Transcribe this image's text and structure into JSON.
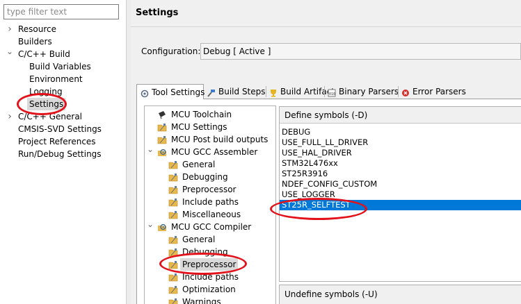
{
  "filter": {
    "placeholder": "type filter text",
    "value": ""
  },
  "nav": {
    "items": [
      {
        "label": "Resource",
        "indent": 0,
        "chevron": "right"
      },
      {
        "label": "Builders",
        "indent": 0,
        "chevron": ""
      },
      {
        "label": "C/C++ Build",
        "indent": 0,
        "chevron": "down"
      },
      {
        "label": "Build Variables",
        "indent": 1,
        "chevron": ""
      },
      {
        "label": "Environment",
        "indent": 1,
        "chevron": ""
      },
      {
        "label": "Logging",
        "indent": 1,
        "chevron": ""
      },
      {
        "label": "Settings",
        "indent": 1,
        "chevron": "",
        "selected": true
      },
      {
        "label": "C/C++ General",
        "indent": 0,
        "chevron": "right"
      },
      {
        "label": "CMSIS-SVD Settings",
        "indent": 0,
        "chevron": ""
      },
      {
        "label": "Project References",
        "indent": 0,
        "chevron": ""
      },
      {
        "label": "Run/Debug Settings",
        "indent": 0,
        "chevron": ""
      }
    ]
  },
  "page": {
    "title": "Settings",
    "config_label": "Configuration:",
    "config_value": "Debug  [ Active ]"
  },
  "tabs": [
    {
      "label": "Tool Settings",
      "icon": "tool-settings-icon",
      "active": true
    },
    {
      "label": "Build Steps",
      "icon": "build-steps-icon"
    },
    {
      "label": "Build Artifact",
      "icon": "build-artifact-icon"
    },
    {
      "label": "Binary Parsers",
      "icon": "binary-parsers-icon"
    },
    {
      "label": "Error Parsers",
      "icon": "error-parsers-icon"
    }
  ],
  "tool_tree": [
    {
      "label": "MCU Toolchain",
      "level": 0,
      "chevron": "",
      "icon": "chip"
    },
    {
      "label": "MCU Settings",
      "level": 0,
      "chevron": "",
      "icon": "folder"
    },
    {
      "label": "MCU Post build outputs",
      "level": 0,
      "chevron": "",
      "icon": "folder"
    },
    {
      "label": "MCU GCC Assembler",
      "level": 0,
      "chevron": "down",
      "icon": "gear"
    },
    {
      "label": "General",
      "level": 1,
      "chevron": "",
      "icon": "folder"
    },
    {
      "label": "Debugging",
      "level": 1,
      "chevron": "",
      "icon": "folder"
    },
    {
      "label": "Preprocessor",
      "level": 1,
      "chevron": "",
      "icon": "folder"
    },
    {
      "label": "Include paths",
      "level": 1,
      "chevron": "",
      "icon": "folder"
    },
    {
      "label": "Miscellaneous",
      "level": 1,
      "chevron": "",
      "icon": "folder"
    },
    {
      "label": "MCU GCC Compiler",
      "level": 0,
      "chevron": "down",
      "icon": "gear"
    },
    {
      "label": "General",
      "level": 1,
      "chevron": "",
      "icon": "folder"
    },
    {
      "label": "Debugging",
      "level": 1,
      "chevron": "",
      "icon": "folder"
    },
    {
      "label": "Preprocessor",
      "level": 1,
      "chevron": "",
      "icon": "folder",
      "selected": true
    },
    {
      "label": "Include paths",
      "level": 1,
      "chevron": "",
      "icon": "folder"
    },
    {
      "label": "Optimization",
      "level": 1,
      "chevron": "",
      "icon": "folder"
    },
    {
      "label": "Warnings",
      "level": 1,
      "chevron": "",
      "icon": "folder"
    }
  ],
  "define": {
    "header": "Define symbols (-D)",
    "items": [
      {
        "label": "DEBUG"
      },
      {
        "label": "USE_FULL_LL_DRIVER"
      },
      {
        "label": "USE_HAL_DRIVER"
      },
      {
        "label": "STM32L476xx"
      },
      {
        "label": "ST25R3916"
      },
      {
        "label": "NDEF_CONFIG_CUSTOM"
      },
      {
        "label": "USE_LOGGER"
      },
      {
        "label": "ST25R_SELFTEST",
        "selected": true
      }
    ]
  },
  "undefine": {
    "header": "Undefine symbols (-U)"
  },
  "colors": {
    "annotation": "#e3121a",
    "selection": "#0078d7",
    "folder": "#e8b94a"
  }
}
